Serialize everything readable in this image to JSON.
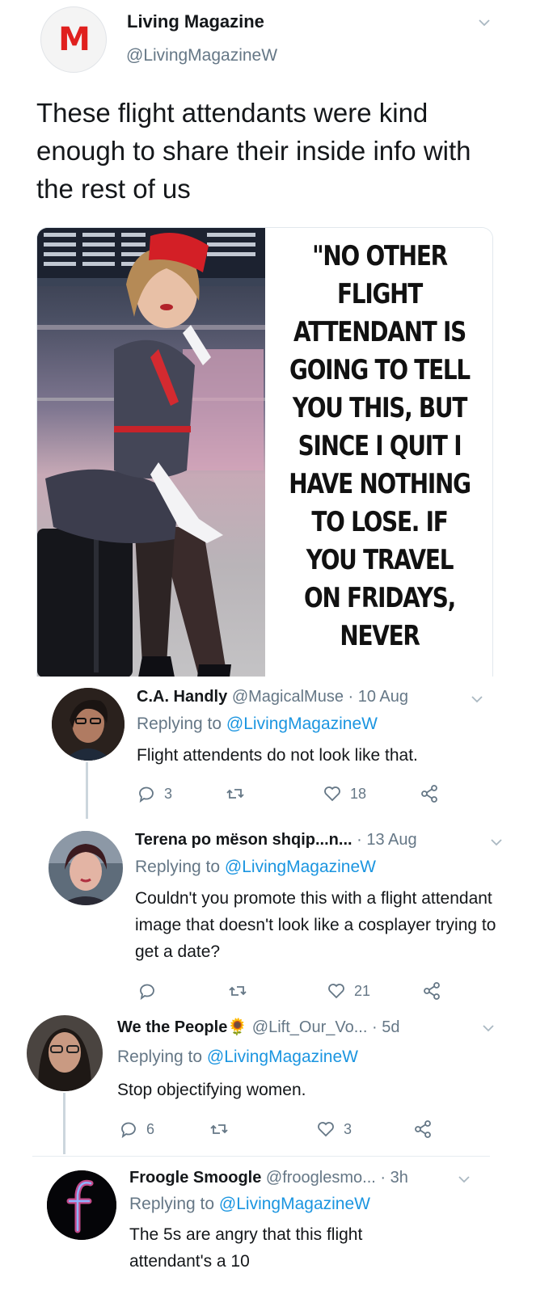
{
  "tweet": {
    "author_name": "Living Magazine",
    "author_handle": "@LivingMagazineW",
    "avatar_text": "M",
    "text": "These flight attendants were kind enough to share their inside info with the rest of us",
    "image_quote": "\"NO OTHER FLIGHT ATTENDANT IS GOING TO TELL YOU THIS, BUT SINCE I QUIT I HAVE NOTHING TO LOSE. IF YOU TRAVEL ON FRIDAYS, NEVER"
  },
  "replies": [
    {
      "name": "C.A. Handly",
      "handle": "@MagicalMuse",
      "time": "10 Aug",
      "replying_label": "Replying to",
      "replying_to": "@LivingMagazineW",
      "text": "Flight attendents do not look like that.",
      "replies_count": "3",
      "retweets_count": "",
      "likes_count": "18"
    },
    {
      "name": "Terena po mëson shqip...n...",
      "handle": "",
      "time": "13 Aug",
      "replying_label": "Replying to",
      "replying_to": "@LivingMagazineW",
      "text": "Couldn't you promote this with a flight attendant image that doesn't look like a cosplayer trying to get a date?",
      "replies_count": "",
      "retweets_count": "",
      "likes_count": "21"
    },
    {
      "name": "We the People",
      "name_emoji": "🌻",
      "handle": "@Lift_Our_Vo...",
      "time": "5d",
      "replying_label": "Replying to",
      "replying_to": "@LivingMagazineW",
      "text": "Stop objectifying women.",
      "replies_count": "6",
      "retweets_count": "",
      "likes_count": "3"
    },
    {
      "name": "Froogle Smoogle",
      "handle": "@frooglesmo...",
      "time": "3h",
      "replying_label": "Replying to",
      "replying_to": "@LivingMagazineW",
      "text": "The 5s are angry that this flight attendant's a 10",
      "avatar_text": "f"
    }
  ],
  "separator": "·",
  "colors": {
    "link": "#1b95e0",
    "secondary_text": "#657786",
    "primary_text": "#14171a",
    "brand_red": "#e0201e"
  }
}
